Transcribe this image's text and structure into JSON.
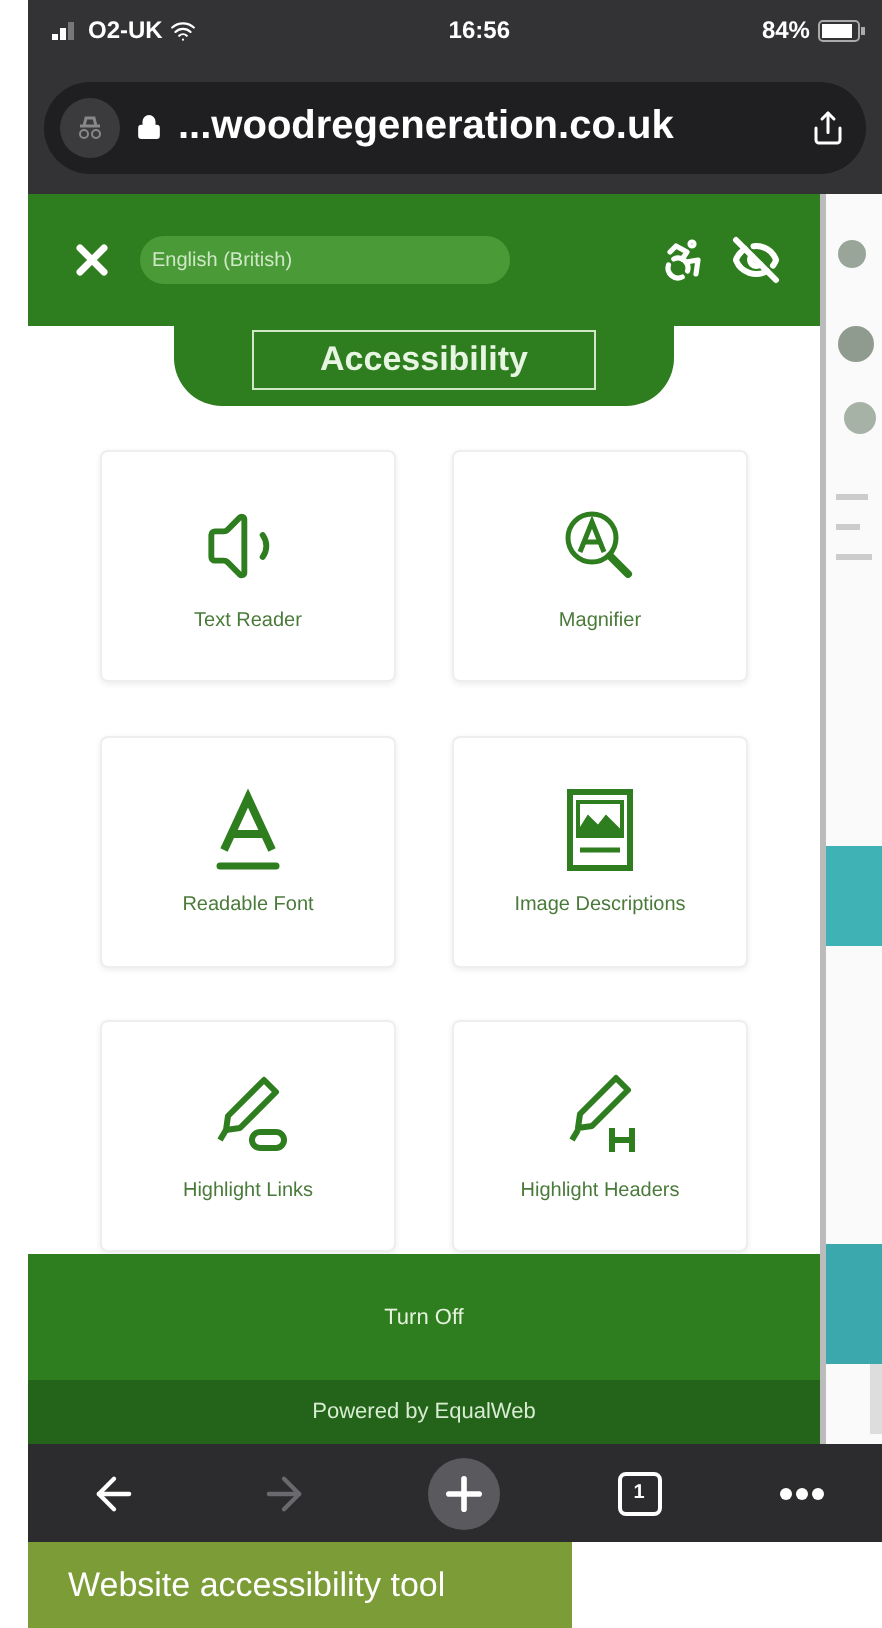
{
  "status_bar": {
    "carrier": "O2-UK",
    "time": "16:56",
    "battery": "84%"
  },
  "browser": {
    "url": "...woodregeneration.co.uk"
  },
  "panel": {
    "language": "English (British)",
    "title": "Accessibility",
    "features": [
      {
        "kind": "text_reader",
        "label": "Text Reader"
      },
      {
        "kind": "magnifier",
        "label": "Magnifier"
      },
      {
        "kind": "readable_font",
        "label": "Readable Font"
      },
      {
        "kind": "image_descriptions",
        "label": "Image Descriptions"
      },
      {
        "kind": "highlight_links",
        "label": "Highlight Links"
      },
      {
        "kind": "highlight_headers",
        "label": "Highlight Headers"
      }
    ],
    "turn_off": "Turn Off",
    "credit": "Powered by EqualWeb"
  },
  "toolbar": [
    {
      "kind": "back",
      "disabled": false
    },
    {
      "kind": "forward",
      "disabled": true
    },
    {
      "kind": "new_tab",
      "disabled": false
    },
    {
      "kind": "tabs",
      "label": "1",
      "disabled": false
    },
    {
      "kind": "more",
      "disabled": false
    }
  ],
  "caption": "Website accessibility tool"
}
